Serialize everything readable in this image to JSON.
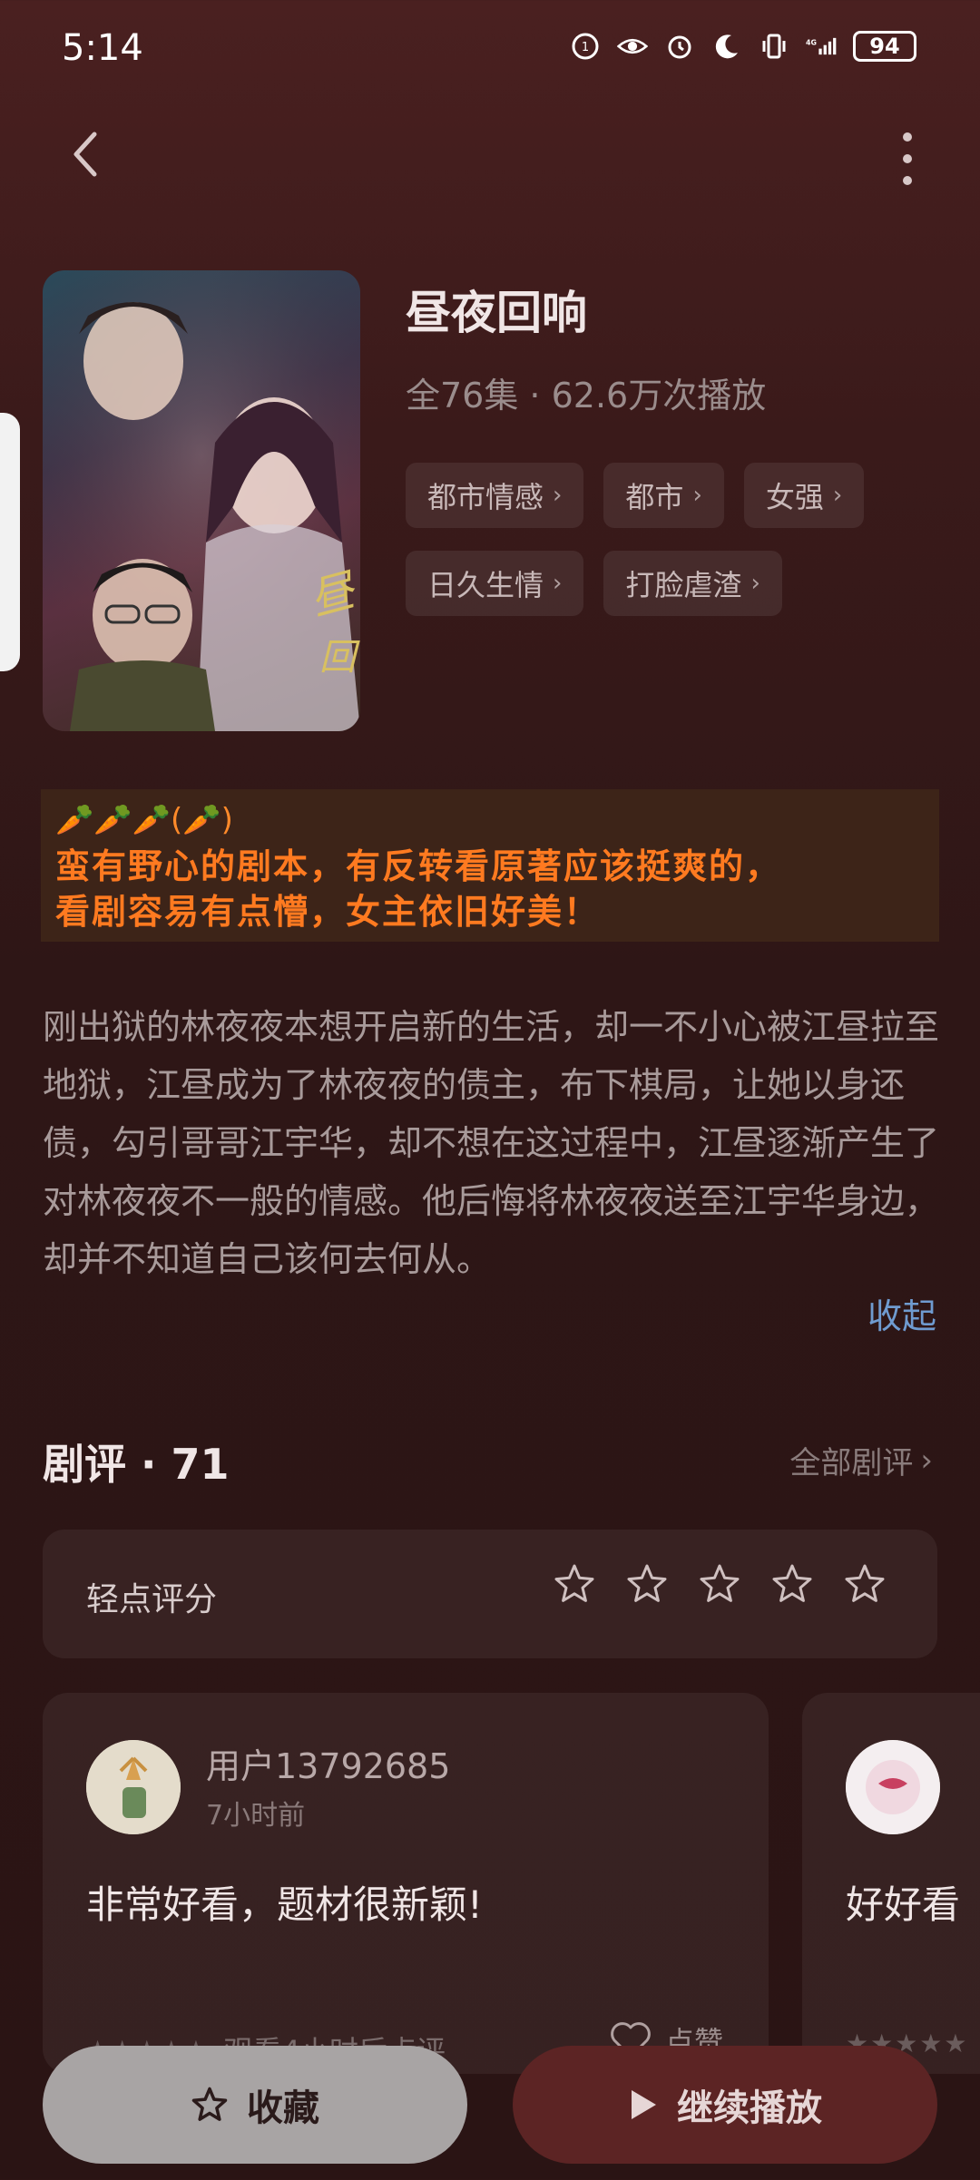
{
  "status": {
    "time": "5:14",
    "battery": "94",
    "network": "4G"
  },
  "show": {
    "title": "昼夜回响",
    "meta": "全76集 · 62.6万次播放",
    "tags": [
      "都市情感",
      "都市",
      "女强",
      "日久生情",
      "打脸虐渣"
    ]
  },
  "note": {
    "line0": "🥕🥕🥕(🥕)",
    "line1": "蛮有野心的剧本，有反转看原著应该挺爽的，",
    "line2": "看剧容易有点懵，女主依旧好美！"
  },
  "synopsis": {
    "text": "刚出狱的林夜夜本想开启新的生活，却一不小心被江昼拉至地狱，江昼成为了林夜夜的债主，布下棋局，让她以身还债，勾引哥哥江宇华，却不想在这过程中，江昼逐渐产生了对林夜夜不一般的情感。他后悔将林夜夜送至江宇华身边，却并不知道自己该何去何从。",
    "collapse": "收起"
  },
  "reviews": {
    "title": "剧评 · 71",
    "all_label": "全部剧评",
    "rating_label": "轻点评分",
    "cards": [
      {
        "user": "用户13792685",
        "time": "7小时前",
        "comment": "非常好看，题材很新颖!",
        "footer": "观看4小时后点评",
        "like": "点赞"
      },
      {
        "comment": "好好看"
      }
    ]
  },
  "bottom": {
    "fav": "收藏",
    "play": "继续播放"
  },
  "colors": {
    "accent_blue": "#6f9bd0",
    "note_orange": "#ff7a20",
    "play_bg": "#5c2424"
  }
}
